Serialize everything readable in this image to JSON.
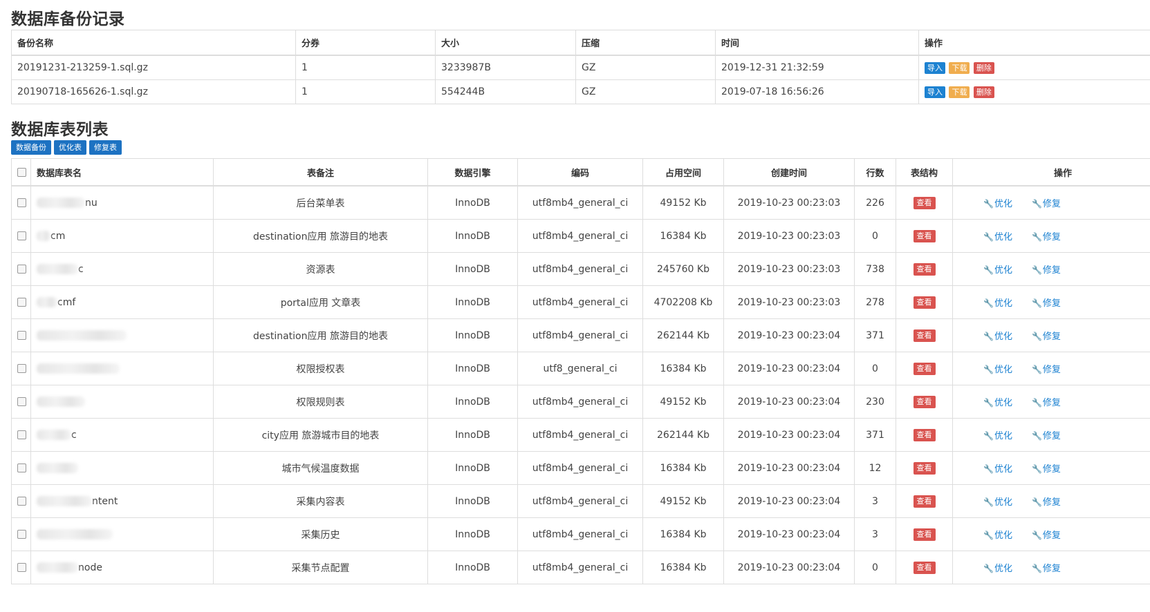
{
  "backup_section": {
    "title": "数据库备份记录",
    "headers": [
      "备份名称",
      "分券",
      "大小",
      "压缩",
      "时间",
      "操作"
    ],
    "rows": [
      {
        "name": "20191231-213259-1.sql.gz",
        "part": "1",
        "size": "3233987B",
        "compress": "GZ",
        "time": "2019-12-31 21:32:59"
      },
      {
        "name": "20190718-165626-1.sql.gz",
        "part": "1",
        "size": "554244B",
        "compress": "GZ",
        "time": "2019-07-18 16:56:26"
      }
    ],
    "actions": {
      "import": "导入",
      "download": "下载",
      "delete": "删除"
    }
  },
  "tables_section": {
    "title": "数据库表列表",
    "toolbar": {
      "backup": "数据备份",
      "optimize": "优化表",
      "repair": "修复表"
    },
    "headers": [
      "数据库表名",
      "表备注",
      "数据引擎",
      "编码",
      "占用空间",
      "创建时间",
      "行数",
      "表结构",
      "操作"
    ],
    "view_label": "查看",
    "optimize_label": "优化",
    "repair_label": "修复",
    "rows": [
      {
        "name_visible": "nu",
        "comment": "后台菜单表",
        "engine": "InnoDB",
        "charset": "utf8mb4_general_ci",
        "space": "49152 Kb",
        "created": "2019-10-23 00:23:03",
        "rows": "226"
      },
      {
        "name_visible": "cm",
        "comment": "destination应用 旅游目的地表",
        "engine": "InnoDB",
        "charset": "utf8mb4_general_ci",
        "space": "16384 Kb",
        "created": "2019-10-23 00:23:03",
        "rows": "0"
      },
      {
        "name_visible": "c",
        "comment": "资源表",
        "engine": "InnoDB",
        "charset": "utf8mb4_general_ci",
        "space": "245760 Kb",
        "created": "2019-10-23 00:23:03",
        "rows": "738"
      },
      {
        "name_visible": "cmf",
        "comment": "portal应用 文章表",
        "engine": "InnoDB",
        "charset": "utf8mb4_general_ci",
        "space": "4702208 Kb",
        "created": "2019-10-23 00:23:03",
        "rows": "278"
      },
      {
        "name_visible": "",
        "comment": "destination应用 旅游目的地表",
        "engine": "InnoDB",
        "charset": "utf8mb4_general_ci",
        "space": "262144 Kb",
        "created": "2019-10-23 00:23:04",
        "rows": "371"
      },
      {
        "name_visible": "",
        "comment": "权限授权表",
        "engine": "InnoDB",
        "charset": "utf8_general_ci",
        "space": "16384 Kb",
        "created": "2019-10-23 00:23:04",
        "rows": "0"
      },
      {
        "name_visible": "",
        "comment": "权限规则表",
        "engine": "InnoDB",
        "charset": "utf8mb4_general_ci",
        "space": "49152 Kb",
        "created": "2019-10-23 00:23:04",
        "rows": "230"
      },
      {
        "name_visible": "c",
        "comment": "city应用 旅游城市目的地表",
        "engine": "InnoDB",
        "charset": "utf8mb4_general_ci",
        "space": "262144 Kb",
        "created": "2019-10-23 00:23:04",
        "rows": "371"
      },
      {
        "name_visible": "",
        "comment": "城市气候温度数据",
        "engine": "InnoDB",
        "charset": "utf8mb4_general_ci",
        "space": "16384 Kb",
        "created": "2019-10-23 00:23:04",
        "rows": "12"
      },
      {
        "name_visible": "ntent",
        "comment": "采集内容表",
        "engine": "InnoDB",
        "charset": "utf8mb4_general_ci",
        "space": "49152 Kb",
        "created": "2019-10-23 00:23:04",
        "rows": "3"
      },
      {
        "name_visible": "",
        "comment": "采集历史",
        "engine": "InnoDB",
        "charset": "utf8mb4_general_ci",
        "space": "16384 Kb",
        "created": "2019-10-23 00:23:04",
        "rows": "3"
      },
      {
        "name_visible": "node",
        "comment": "采集节点配置",
        "engine": "InnoDB",
        "charset": "utf8mb4_general_ci",
        "space": "16384 Kb",
        "created": "2019-10-23 00:23:04",
        "rows": "0"
      }
    ]
  },
  "colors": {
    "primary": "#1d82d1",
    "warning": "#f0ad4e",
    "danger": "#d9534f"
  }
}
